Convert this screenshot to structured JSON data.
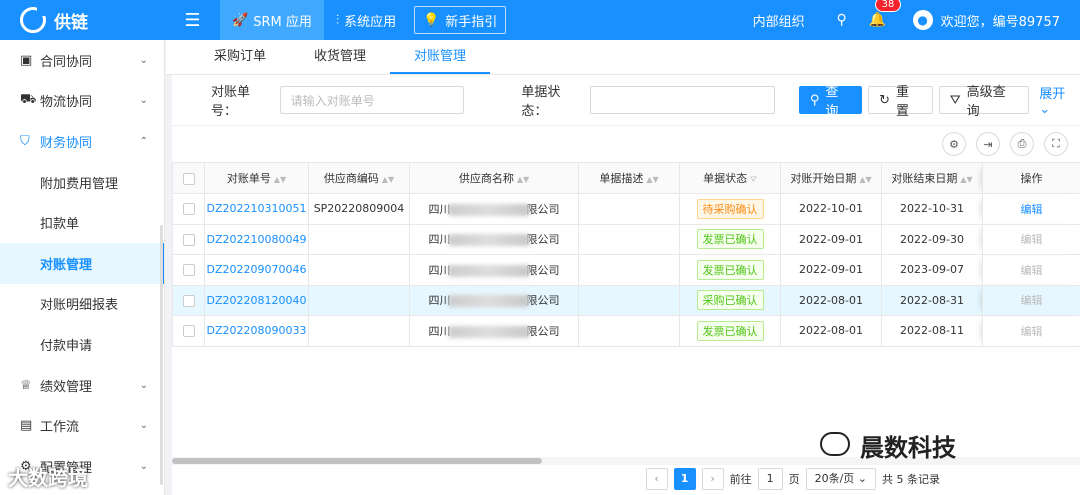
{
  "header": {
    "logo_text": "供链",
    "nav": [
      {
        "label": "SRM 应用",
        "icon": "rocket-icon"
      },
      {
        "label": "系统应用",
        "icon": "sliders-icon"
      }
    ],
    "guide_label": "新手指引",
    "org_label": "内部组织",
    "notification_count": "38",
    "welcome": "欢迎您，编号89757"
  },
  "sidebar": {
    "items": [
      {
        "label": "合同协同",
        "icon": "contract-icon"
      },
      {
        "label": "物流协同",
        "icon": "truck-icon"
      },
      {
        "label": "财务协同",
        "icon": "shield-icon"
      },
      {
        "label": "附加费用管理"
      },
      {
        "label": "扣款单"
      },
      {
        "label": "对账管理"
      },
      {
        "label": "对账明细报表"
      },
      {
        "label": "付款申请"
      },
      {
        "label": "绩效管理",
        "icon": "trophy-icon"
      },
      {
        "label": "工作流",
        "icon": "document-icon"
      },
      {
        "label": "配置管理",
        "icon": "gear-icon"
      }
    ]
  },
  "tabs": [
    "采购订单",
    "收货管理",
    "对账管理"
  ],
  "filter": {
    "no_label": "对账单号",
    "no_placeholder": "请输入对账单号",
    "status_label": "单据状态",
    "status_placeholder": "",
    "query": "查询",
    "reset": "重置",
    "advanced": "高级查询",
    "expand": "展开"
  },
  "table": {
    "columns": [
      "对账单号",
      "供应商编码",
      "供应商名称",
      "单据描述",
      "单据状态",
      "对账开始日期",
      "对账结束日期",
      "操作"
    ],
    "rows": [
      {
        "no": "DZ202210310051",
        "code": "SP20220809004",
        "name_pre": "四川",
        "name_post": "限公司",
        "desc": "",
        "status": "待采购确认",
        "start": "2022-10-01",
        "end": "2022-10-31",
        "op": "编辑"
      },
      {
        "no": "DZ202210080049",
        "code": "",
        "name_pre": "四川",
        "name_post": "限公司",
        "desc": "",
        "status": "发票已确认",
        "start": "2022-09-01",
        "end": "2022-09-30",
        "op": "编辑"
      },
      {
        "no": "DZ202209070046",
        "code": "",
        "name_pre": "四川",
        "name_post": "限公司",
        "desc": "",
        "status": "发票已确认",
        "start": "2022-09-01",
        "end": "2023-09-07",
        "op": "编辑"
      },
      {
        "no": "DZ202208120040",
        "code": "",
        "name_pre": "四川",
        "name_post": "限公司",
        "desc": "",
        "status": "采购已确认",
        "start": "2022-08-01",
        "end": "2022-08-31",
        "op": "编辑"
      },
      {
        "no": "DZ202208090033",
        "code": "",
        "name_pre": "四川",
        "name_post": "限公司",
        "desc": "",
        "status": "发票已确认",
        "start": "2022-08-01",
        "end": "2022-08-11",
        "op": "编辑"
      }
    ]
  },
  "pager": {
    "current": "1",
    "goto_label": "前往",
    "goto_value": "1",
    "page_unit": "页",
    "page_size": "20条/页",
    "total": "共 5 条记录"
  },
  "watermarks": {
    "right": "晨数科技",
    "left": "大数跨境"
  }
}
